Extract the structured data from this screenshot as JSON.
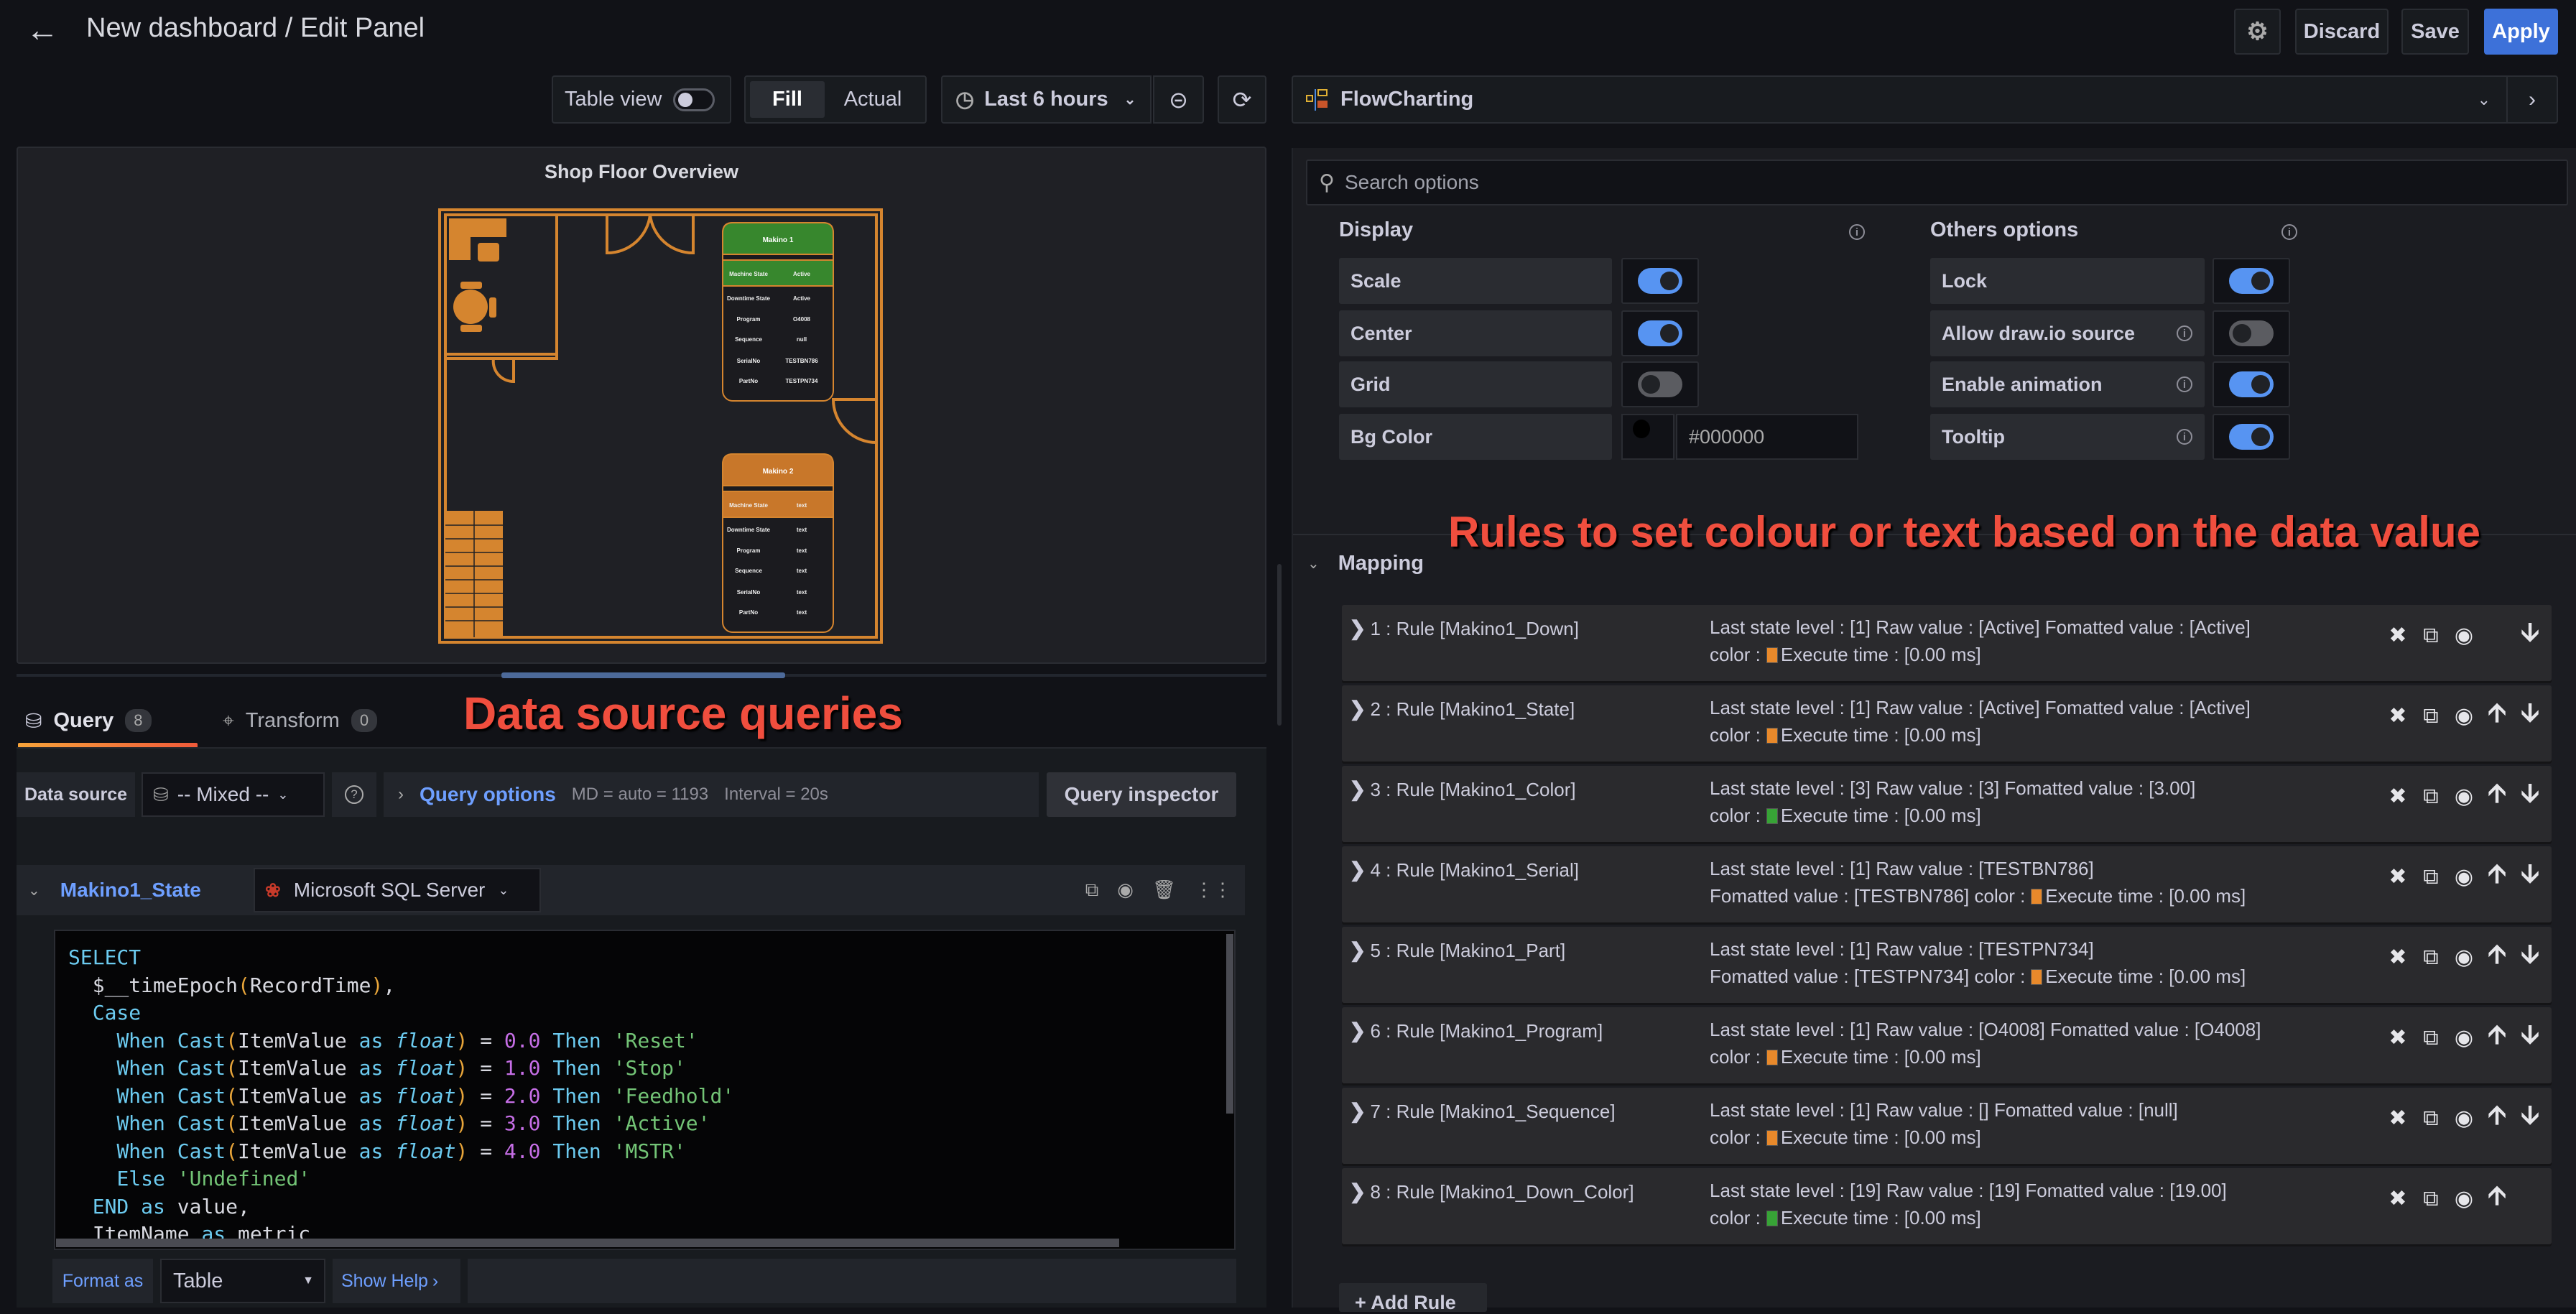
{
  "header": {
    "title": "New dashboard / Edit Panel",
    "back_icon": "arrow-left-icon",
    "settings_icon": "gear-icon",
    "discard_label": "Discard",
    "save_label": "Save",
    "apply_label": "Apply"
  },
  "toolbar": {
    "table_view_label": "Table view",
    "table_view_on": false,
    "fill_label": "Fill",
    "actual_label": "Actual",
    "fill_selected": true,
    "time_range": "Last 6 hours",
    "zoom_out_icon": "zoom-out-icon",
    "refresh_icon": "refresh-icon"
  },
  "visualization": {
    "name": "FlowCharting",
    "icon": "flowchart-icon"
  },
  "panel": {
    "title": "Shop Floor Overview",
    "machines": [
      {
        "name": "Makino 1",
        "header_color": "#37872d",
        "rows": [
          {
            "label": "Machine State",
            "value": "Active"
          },
          {
            "label": "Downtime State",
            "value": "Active"
          },
          {
            "label": "Program",
            "value": "O4008"
          },
          {
            "label": "Sequence",
            "value": "null"
          },
          {
            "label": "SerialNo",
            "value": "TESTBN786"
          },
          {
            "label": "PartNo",
            "value": "TESTPN734"
          }
        ]
      },
      {
        "name": "Makino 2",
        "header_color": "#c8772a",
        "rows": [
          {
            "label": "Machine State",
            "value": "text"
          },
          {
            "label": "Downtime State",
            "value": "text"
          },
          {
            "label": "Program",
            "value": "text"
          },
          {
            "label": "Sequence",
            "value": "text"
          },
          {
            "label": "SerialNo",
            "value": "text"
          },
          {
            "label": "PartNo",
            "value": "text"
          }
        ]
      }
    ],
    "wall_color": "#d5852f"
  },
  "annotations": {
    "queries": "Data source queries",
    "rules": "Rules to set colour or text based on the data value"
  },
  "tabs": [
    {
      "label": "Query",
      "count": "8",
      "icon": "database-icon",
      "active": true
    },
    {
      "label": "Transform",
      "count": "0",
      "icon": "transform-icon",
      "active": false
    }
  ],
  "datasource_row": {
    "label": "Data source",
    "value": "-- Mixed --",
    "help_icon": "question-circle-icon",
    "query_options_label": "Query options",
    "md": "MD = auto = 1193",
    "interval": "Interval = 20s",
    "inspector_label": "Query inspector"
  },
  "query": {
    "ref_name": "Makino1_State",
    "datasource": "Microsoft SQL Server",
    "actions": [
      "duplicate-icon",
      "eye-icon",
      "trash-icon",
      "drag-handle-icon"
    ],
    "code_lines": [
      "SELECT",
      "  $__timeEpoch(RecordTime),",
      "  Case",
      "    When Cast(ItemValue as float) = 0.0 Then 'Reset'",
      "    When Cast(ItemValue as float) = 1.0 Then 'Stop'",
      "    When Cast(ItemValue as float) = 2.0 Then 'Feedhold'",
      "    When Cast(ItemValue as float) = 3.0 Then 'Active'",
      "    When Cast(ItemValue as float) = 4.0 Then 'MSTR'",
      "    Else 'Undefined'",
      "  END as value,",
      "  ItemName as metric"
    ],
    "format_as_label": "Format as",
    "format_as_value": "Table",
    "show_help_label": "Show Help"
  },
  "options": {
    "search_placeholder": "Search options",
    "display": {
      "title": "Display",
      "items": [
        {
          "label": "Scale",
          "on": true
        },
        {
          "label": "Center",
          "on": true
        },
        {
          "label": "Grid",
          "on": false
        }
      ],
      "bg_color_label": "Bg Color",
      "bg_color_value": "#000000"
    },
    "others": {
      "title": "Others options",
      "items": [
        {
          "label": "Lock",
          "on": true,
          "info": false
        },
        {
          "label": "Allow draw.io source",
          "on": false,
          "info": true
        },
        {
          "label": "Enable animation",
          "on": true,
          "info": true
        },
        {
          "label": "Tooltip",
          "on": true,
          "info": true
        }
      ]
    },
    "mapping": {
      "title": "Mapping",
      "add_rule_label": "+ Add Rule",
      "rules": [
        {
          "name": "1 : Rule [Makino1_Down]",
          "line1": "Last state level : [1]  Raw value : [Active]  Fomatted value : [Active]",
          "line2_prefix": "color :",
          "color": "#e8892b",
          "exec": "Execute time : [0.00 ms]",
          "up": false,
          "down": true
        },
        {
          "name": "2 : Rule [Makino1_State]",
          "line1": "Last state level : [1]  Raw value : [Active]  Fomatted value : [Active]",
          "line2_prefix": "color :",
          "color": "#e8892b",
          "exec": "Execute time : [0.00 ms]",
          "up": true,
          "down": true
        },
        {
          "name": "3 : Rule [Makino1_Color]",
          "line1": "Last state level : [3]  Raw value : [3]  Fomatted value : [3.00]",
          "line2_prefix": "color :",
          "color": "#37a336",
          "exec": "Execute time : [0.00 ms]",
          "up": true,
          "down": true
        },
        {
          "name": "4 : Rule [Makino1_Serial]",
          "line1": "Last state level : [1]  Raw value : [TESTBN786]",
          "line2_prefix": "Fomatted value : [TESTBN786]  color :",
          "color": "#e8892b",
          "exec": "Execute time : [0.00 ms]",
          "up": true,
          "down": true
        },
        {
          "name": "5 : Rule [Makino1_Part]",
          "line1": "Last state level : [1]  Raw value : [TESTPN734]",
          "line2_prefix": "Fomatted value : [TESTPN734]  color :",
          "color": "#e8892b",
          "exec": "Execute time : [0.00 ms]",
          "up": true,
          "down": true
        },
        {
          "name": "6 : Rule [Makino1_Program]",
          "line1": "Last state level : [1]  Raw value : [O4008]  Fomatted value : [O4008]",
          "line2_prefix": "color :",
          "color": "#e8892b",
          "exec": "Execute time : [0.00 ms]",
          "up": true,
          "down": true
        },
        {
          "name": "7 : Rule [Makino1_Sequence]",
          "line1": "Last state level : [1]  Raw value : []  Fomatted value : [null]",
          "line2_prefix": "color :",
          "color": "#e8892b",
          "exec": "Execute time : [0.00 ms]",
          "up": true,
          "down": true
        },
        {
          "name": "8 : Rule [Makino1_Down_Color]",
          "line1": "Last state level : [19]  Raw value : [19]  Fomatted value : [19.00]",
          "line2_prefix": "color :",
          "color": "#37a336",
          "exec": "Execute time : [0.00 ms]",
          "up": true,
          "down": false
        }
      ]
    }
  }
}
